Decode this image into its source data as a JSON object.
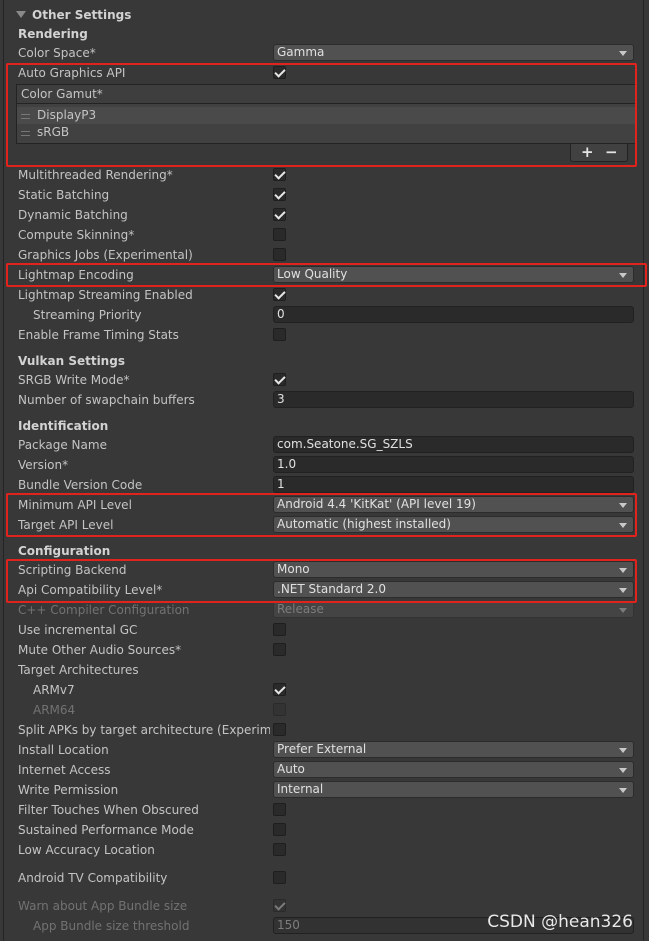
{
  "title": "Other Settings",
  "sections": {
    "rendering": "Rendering",
    "vulkan": "Vulkan Settings",
    "identification": "Identification",
    "configuration": "Configuration"
  },
  "rendering": {
    "color_space": {
      "label": "Color Space*",
      "value": "Gamma"
    },
    "auto_graphics_api": {
      "label": "Auto Graphics API",
      "checked": true
    },
    "color_gamut": {
      "label": "Color Gamut*",
      "items": [
        "DisplayP3",
        "sRGB"
      ],
      "add": "+",
      "remove": "−"
    },
    "multithreaded": {
      "label": "Multithreaded Rendering*",
      "checked": true
    },
    "static_batching": {
      "label": "Static Batching",
      "checked": true
    },
    "dynamic_batching": {
      "label": "Dynamic Batching",
      "checked": true
    },
    "compute_skinning": {
      "label": "Compute Skinning*",
      "checked": false
    },
    "graphics_jobs": {
      "label": "Graphics Jobs (Experimental)",
      "checked": false
    },
    "lightmap_encoding": {
      "label": "Lightmap Encoding",
      "value": "Low Quality"
    },
    "lightmap_streaming": {
      "label": "Lightmap Streaming Enabled",
      "checked": true
    },
    "streaming_priority": {
      "label": "Streaming Priority",
      "value": "0"
    },
    "frame_timing": {
      "label": "Enable Frame Timing Stats",
      "checked": false
    }
  },
  "vulkan": {
    "srgb_write": {
      "label": "SRGB Write Mode*",
      "checked": true
    },
    "swapchain": {
      "label": "Number of swapchain buffers",
      "value": "3"
    }
  },
  "identification": {
    "package_name": {
      "label": "Package Name",
      "value": "com.Seatone.SG_SZLS"
    },
    "version": {
      "label": "Version*",
      "value": "1.0"
    },
    "bundle_code": {
      "label": "Bundle Version Code",
      "value": "1"
    },
    "min_api": {
      "label": "Minimum API Level",
      "value": "Android 4.4 'KitKat' (API level 19)"
    },
    "target_api": {
      "label": "Target API Level",
      "value": "Automatic (highest installed)"
    }
  },
  "configuration": {
    "scripting_backend": {
      "label": "Scripting Backend",
      "value": "Mono"
    },
    "api_compat": {
      "label": "Api Compatibility Level*",
      "value": ".NET Standard 2.0"
    },
    "cpp_config": {
      "label": "C++ Compiler Configuration",
      "value": "Release"
    },
    "incremental_gc": {
      "label": "Use incremental GC",
      "checked": false
    },
    "mute_audio": {
      "label": "Mute Other Audio Sources*",
      "checked": false
    },
    "target_arch": {
      "label": "Target Architectures"
    },
    "armv7": {
      "label": "ARMv7",
      "checked": true
    },
    "arm64": {
      "label": "ARM64",
      "checked": false
    },
    "split_apks": {
      "label": "Split APKs by target architecture (Experimental)",
      "checked": false
    },
    "install_location": {
      "label": "Install Location",
      "value": "Prefer External"
    },
    "internet_access": {
      "label": "Internet Access",
      "value": "Auto"
    },
    "write_permission": {
      "label": "Write Permission",
      "value": "Internal"
    },
    "filter_touches": {
      "label": "Filter Touches When Obscured",
      "checked": false
    },
    "sustained_perf": {
      "label": "Sustained Performance Mode",
      "checked": false
    },
    "low_accuracy": {
      "label": "Low Accuracy Location",
      "checked": false
    },
    "android_tv": {
      "label": "Android TV Compatibility",
      "checked": false
    },
    "warn_bundle": {
      "label": "Warn about App Bundle size",
      "checked": true
    },
    "bundle_threshold": {
      "label": "App Bundle size threshold",
      "value": "150"
    }
  },
  "watermark": "CSDN @hean326",
  "highlight_color": "#e0241d"
}
